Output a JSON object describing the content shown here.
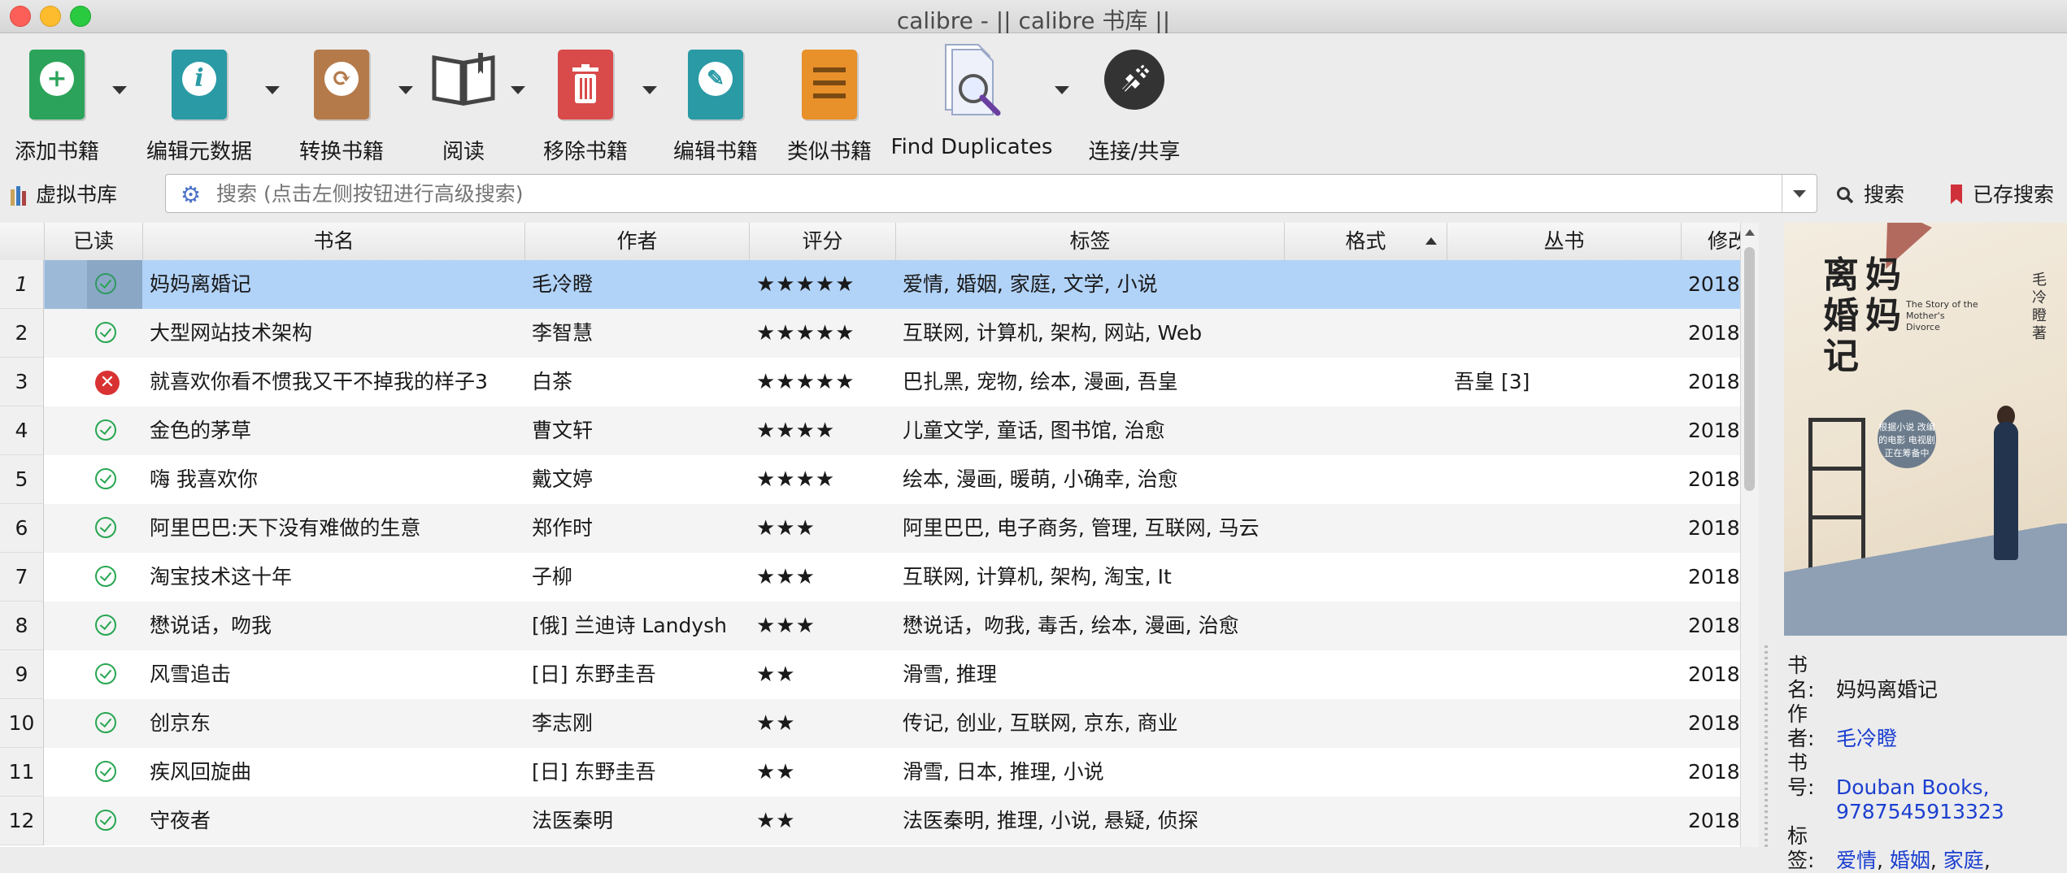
{
  "window": {
    "title": "calibre - || calibre 书库 ||"
  },
  "toolbar": {
    "buttons": [
      {
        "label": "添加书籍",
        "color": "#2ba35a",
        "icon": "add-book-icon"
      },
      {
        "label": "编辑元数据",
        "color": "#2a9aa5",
        "icon": "info-book-icon"
      },
      {
        "label": "转换书籍",
        "color": "#b57a4a",
        "icon": "convert-book-icon"
      },
      {
        "label": "阅读",
        "color": "#444444",
        "icon": "open-book-icon"
      },
      {
        "label": "移除书籍",
        "color": "#d94a4a",
        "icon": "trash-book-icon"
      },
      {
        "label": "编辑书籍",
        "color": "#2a9aa5",
        "icon": "edit-book-icon"
      },
      {
        "label": "类似书籍",
        "color": "#e8902a",
        "icon": "similar-book-icon"
      },
      {
        "label": "Find Duplicates",
        "color": "#7a8cc8",
        "icon": "find-duplicates-icon"
      },
      {
        "label": "连接/共享",
        "color": "#333333",
        "icon": "connect-share-icon"
      }
    ]
  },
  "search": {
    "virtual_library": "虚拟书库",
    "placeholder": "搜索 (点击左侧按钮进行高级搜索)",
    "search_button": "搜索",
    "saved_search_button": "已存搜索"
  },
  "table": {
    "headers": {
      "read": "已读",
      "title": "书名",
      "author": "作者",
      "rating": "评分",
      "tags": "标签",
      "format": "格式",
      "series": "丛书",
      "modified": "修改"
    },
    "rows": [
      {
        "num": "1",
        "read": true,
        "title": "妈妈离婚记",
        "author": "毛冷瞪",
        "rating": "★★★★★",
        "tags": "爱情, 婚姻, 家庭, 文学, 小说",
        "series": "",
        "modified": "2018-"
      },
      {
        "num": "2",
        "read": true,
        "title": "大型网站技术架构",
        "author": "李智慧",
        "rating": "★★★★★",
        "tags": "互联网, 计算机, 架构, 网站, Web",
        "series": "",
        "modified": "2018-"
      },
      {
        "num": "3",
        "read": false,
        "title": "就喜欢你看不惯我又干不掉我的样子3",
        "author": "白茶",
        "rating": "★★★★★",
        "tags": "巴扎黑, 宠物, 绘本, 漫画, 吾皇",
        "series": "吾皇 [3]",
        "modified": "2018-"
      },
      {
        "num": "4",
        "read": true,
        "title": "金色的茅草",
        "author": "曹文轩",
        "rating": "★★★★",
        "tags": "儿童文学, 童话, 图书馆, 治愈",
        "series": "",
        "modified": "2018-"
      },
      {
        "num": "5",
        "read": true,
        "title": "嗨 我喜欢你",
        "author": "戴文婷",
        "rating": "★★★★",
        "tags": "绘本, 漫画, 暖萌, 小确幸, 治愈",
        "series": "",
        "modified": "2018-"
      },
      {
        "num": "6",
        "read": true,
        "title": "阿里巴巴:天下没有难做的生意",
        "author": "郑作时",
        "rating": "★★★",
        "tags": "阿里巴巴, 电子商务, 管理, 互联网, 马云",
        "series": "",
        "modified": "2018-"
      },
      {
        "num": "7",
        "read": true,
        "title": "淘宝技术这十年",
        "author": "子柳",
        "rating": "★★★",
        "tags": "互联网, 计算机, 架构, 淘宝, It",
        "series": "",
        "modified": "2018-"
      },
      {
        "num": "8",
        "read": true,
        "title": "懋说话，吻我",
        "author": "[俄] 兰迪诗 Landysh",
        "rating": "★★★",
        "tags": "懋说话，吻我, 毒舌, 绘本, 漫画, 治愈",
        "series": "",
        "modified": "2018-"
      },
      {
        "num": "9",
        "read": true,
        "title": "风雪追击",
        "author": "[日] 东野圭吾",
        "rating": "★★",
        "tags": "滑雪, 推理",
        "series": "",
        "modified": "2018-"
      },
      {
        "num": "10",
        "read": true,
        "title": "创京东",
        "author": "李志刚",
        "rating": "★★",
        "tags": "传记, 创业, 互联网, 京东, 商业",
        "series": "",
        "modified": "2018-"
      },
      {
        "num": "11",
        "read": true,
        "title": "疾风回旋曲",
        "author": "[日] 东野圭吾",
        "rating": "★★",
        "tags": "滑雪, 日本, 推理, 小说",
        "series": "",
        "modified": "2018-"
      },
      {
        "num": "12",
        "read": true,
        "title": "守夜者",
        "author": "法医秦明",
        "rating": "★★",
        "tags": "法医秦明, 推理, 小说, 悬疑, 侦探",
        "series": "",
        "modified": "2018-"
      }
    ]
  },
  "cover": {
    "title_col1": "离婚",
    "title_col2": "妈妈",
    "title_col3": "记",
    "subtitle_en": "The Story of the Mother's Divorce",
    "author_vertical": "毛冷瞪 著",
    "badge": "根据小说 改编的电影 电视剧 正在筹备中"
  },
  "details": {
    "title_label": "书名:",
    "title": "妈妈离婚记",
    "author_label": "作者:",
    "author": "毛冷瞪",
    "ids_label": "书号:",
    "ids_line1": "Douban Books,",
    "ids_line2": "9787545913323",
    "tags_label": "标签:",
    "tags": [
      "爱情",
      "婚姻",
      "家庭"
    ]
  }
}
